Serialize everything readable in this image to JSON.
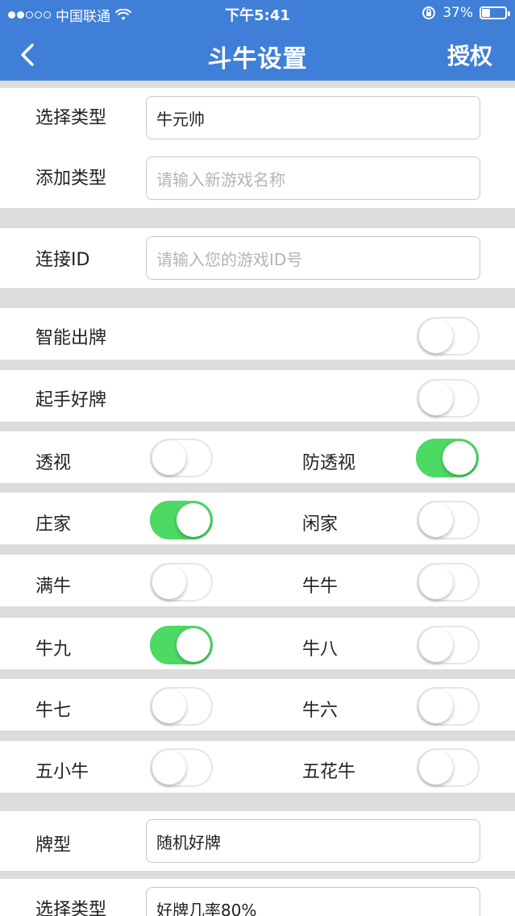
{
  "status_bar": {
    "carrier": "中国联通",
    "time": "下午5:41",
    "battery_percent": "37%",
    "battery_level": 0.37
  },
  "navbar": {
    "title": "斗牛设置",
    "right_label": "授权"
  },
  "form": {
    "select_type": {
      "label": "选择类型",
      "value": "牛元帅"
    },
    "add_type": {
      "label": "添加类型",
      "placeholder": "请输入新游戏名称"
    },
    "connect_id": {
      "label": "连接ID",
      "placeholder": "请输入您的游戏ID号"
    }
  },
  "switches": {
    "smart_play": {
      "label": "智能出牌",
      "on": false
    },
    "good_start": {
      "label": "起手好牌",
      "on": false
    },
    "see_through": {
      "label": "透视",
      "on": false
    },
    "anti_see_through": {
      "label": "防透视",
      "on": true
    },
    "banker": {
      "label": "庄家",
      "on": true
    },
    "idle": {
      "label": "闲家",
      "on": false
    },
    "full_niu": {
      "label": "满牛",
      "on": false
    },
    "niu_niu": {
      "label": "牛牛",
      "on": false
    },
    "niu_nine": {
      "label": "牛九",
      "on": true
    },
    "niu_eight": {
      "label": "牛八",
      "on": false
    },
    "niu_seven": {
      "label": "牛七",
      "on": false
    },
    "niu_six": {
      "label": "牛六",
      "on": false
    },
    "five_small": {
      "label": "五小牛",
      "on": false
    },
    "five_flower": {
      "label": "五花牛",
      "on": false
    }
  },
  "card_type": {
    "label": "牌型",
    "value": "随机好牌"
  },
  "select_type_2": {
    "label": "选择类型",
    "value": "好牌几率80%"
  },
  "colors": {
    "header": "#3f7fd7",
    "toggle_on": "#4cd964",
    "section_bg": "#dcdcdc"
  }
}
